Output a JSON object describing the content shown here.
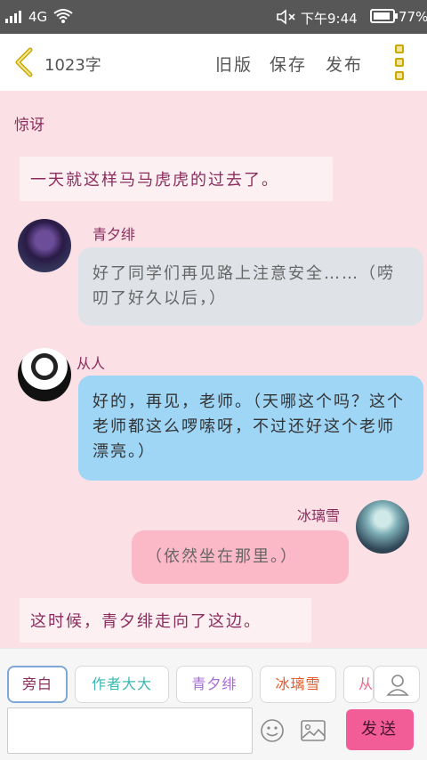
{
  "status_bar": {
    "network": "4G",
    "time": "下午9:44",
    "battery": "77%"
  },
  "header": {
    "word_count": "1023字",
    "old_version": "旧版",
    "save": "保存",
    "publish": "发布"
  },
  "chat": {
    "heading": "惊讶",
    "messages": [
      {
        "type": "narration",
        "text": "一天就这样马马虎虎的过去了。"
      },
      {
        "type": "left",
        "name": "青夕绯",
        "text": "好了同学们再见路上注意安全……（唠叨了好久以后，）"
      },
      {
        "type": "left",
        "name": "从人",
        "text": "好的，再见，老师。（天哪这个吗？这个老师都这么啰嗦呀，不过还好这个老师漂亮。）"
      },
      {
        "type": "right",
        "name": "冰璃雪",
        "text": "（依然坐在那里。）"
      },
      {
        "type": "narration",
        "text": "这时候，青夕绯走向了这边。"
      }
    ]
  },
  "roles": [
    {
      "label": "旁白",
      "color": "#8a2d5c"
    },
    {
      "label": "作者大大",
      "color": "#3bb8b2"
    },
    {
      "label": "青夕绯",
      "color": "#a86bd6"
    },
    {
      "label": "冰璃雪",
      "color": "#e05a2a"
    },
    {
      "label": "从人",
      "color": "#e86a8a"
    }
  ],
  "composer": {
    "input_value": "",
    "send_label": "发送"
  },
  "colors": {
    "background": "#fbe0e6",
    "accent": "#f25d98",
    "bubble_gray": "#dfe3e8",
    "bubble_blue": "#9fd5f5",
    "bubble_pink": "#fbb9c8"
  }
}
